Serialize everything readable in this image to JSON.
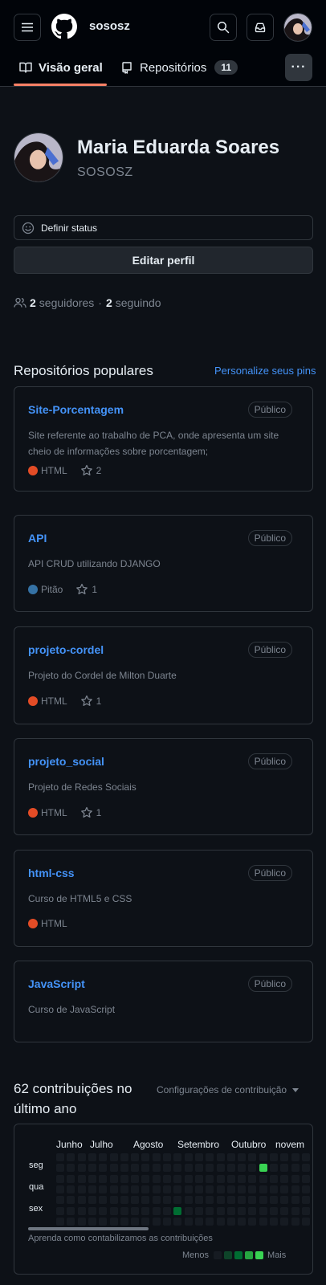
{
  "header": {
    "username": "sososz",
    "tabs": [
      {
        "label": "Visão geral"
      },
      {
        "label": "Repositórios",
        "count": "11"
      }
    ]
  },
  "profile": {
    "full_name": "Maria Eduarda Soares",
    "login": "SOSOSZ",
    "status_label": "Definir status",
    "edit_label": "Editar perfil",
    "followers_count": "2",
    "followers_label": "seguidores",
    "separator": "·",
    "following_count": "2",
    "following_label": "seguindo"
  },
  "pinned": {
    "title": "Repositórios populares",
    "customize_label": "Personalize seus pins",
    "repos": [
      {
        "name": "Site-Porcentagem",
        "visibility": "Público",
        "description": "Site referente ao trabalho de PCA, onde apresenta um site cheio de informações sobre porcentagem;",
        "language": "HTML",
        "lang_color": "#e34c26",
        "stars": "2"
      },
      {
        "name": "API",
        "visibility": "Público",
        "description": "API CRUD utilizando DJANGO",
        "language": "Pitão",
        "lang_color": "#3572A5",
        "stars": "1"
      },
      {
        "name": "projeto-cordel",
        "visibility": "Público",
        "description": "Projeto do Cordel de Milton Duarte",
        "language": "HTML",
        "lang_color": "#e34c26",
        "stars": "1"
      },
      {
        "name": "projeto_social",
        "visibility": "Público",
        "description": "Projeto de Redes Sociais",
        "language": "HTML",
        "lang_color": "#e34c26",
        "stars": "1"
      },
      {
        "name": "html-css",
        "visibility": "Público",
        "description": "Curso de HTML5 e CSS",
        "language": "HTML",
        "lang_color": "#e34c26",
        "stars": ""
      },
      {
        "name": "JavaScript",
        "visibility": "Público",
        "description": "Curso de JavaScript",
        "language": "",
        "lang_color": "",
        "stars": ""
      }
    ]
  },
  "contributions": {
    "title": "62 contribuições no último ano",
    "settings_label": "Configurações de contribuição",
    "months": [
      "Junho",
      "Julho",
      "Agosto",
      "Setembro",
      "Outubro",
      "novem"
    ],
    "day_labels": [
      "seg",
      "qua",
      "sex"
    ],
    "learn_label": "Aprenda como contabilizamos as contribuições",
    "legend_less": "Menos",
    "legend_more": "Mais",
    "legend_colors": [
      "#161b22",
      "#0e4429",
      "#006d32",
      "#26a641",
      "#39d353"
    ],
    "active_cells": [
      {
        "week": 19,
        "day": 1,
        "level": 4
      },
      {
        "week": 11,
        "day": 5,
        "level": 2
      },
      {
        "week": 18,
        "day": 7,
        "level": 4
      }
    ]
  }
}
